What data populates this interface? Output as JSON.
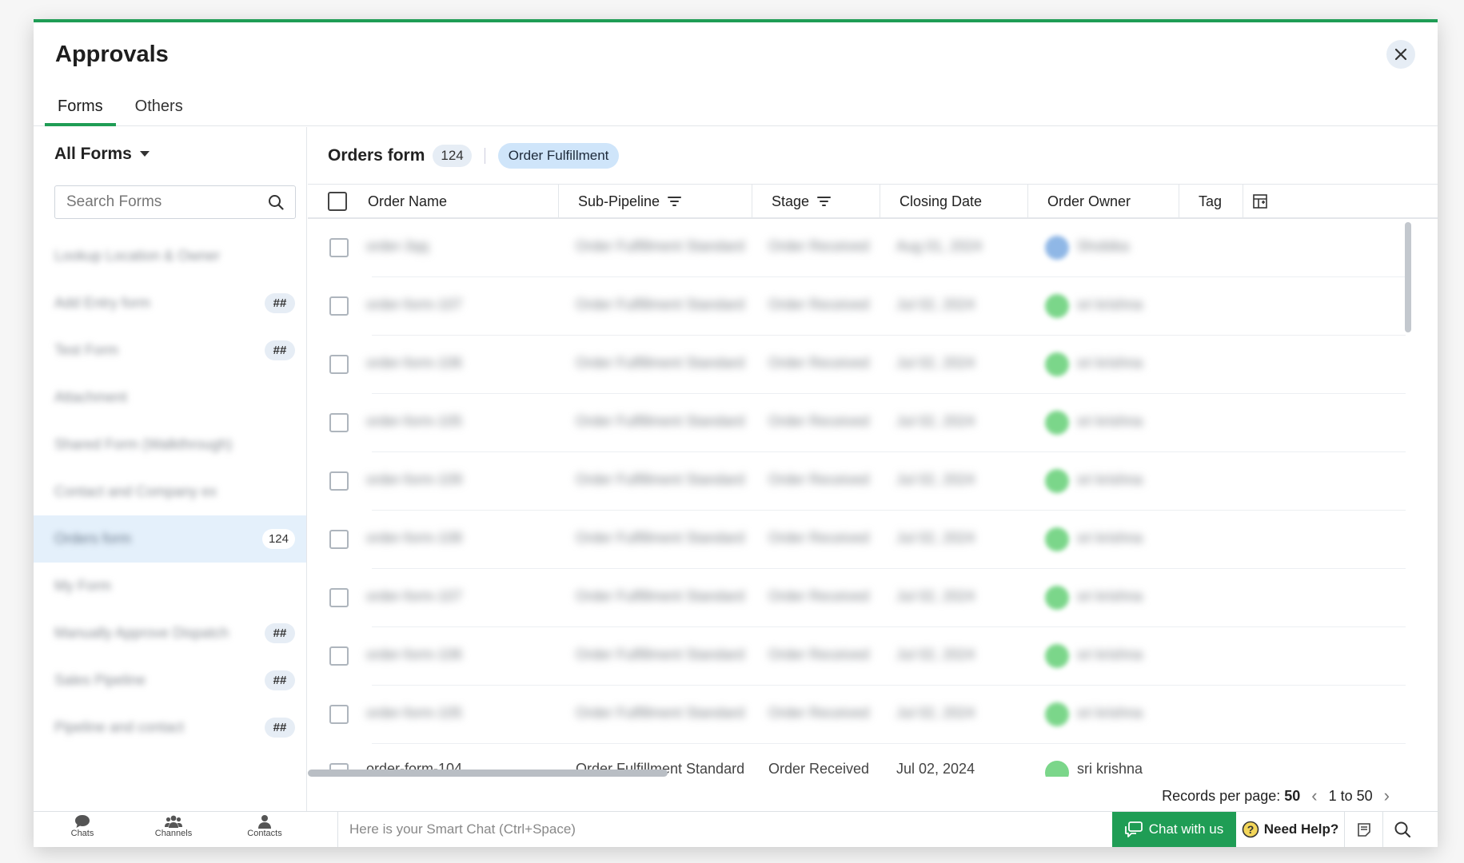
{
  "title": "Approvals",
  "tabs": [
    "Forms",
    "Others"
  ],
  "sidebar": {
    "dropdown_label": "All Forms",
    "search_placeholder": "Search Forms",
    "items": [
      {
        "name": "Lookup Location & Owner",
        "badge": ""
      },
      {
        "name": "Add Entry form",
        "badge": "##"
      },
      {
        "name": "Test Form",
        "badge": "##"
      },
      {
        "name": "Attachment",
        "badge": ""
      },
      {
        "name": "Shared Form (Walkthrough)",
        "badge": ""
      },
      {
        "name": "Contact and Company ex",
        "badge": ""
      },
      {
        "name": "Orders form",
        "badge": "124",
        "selected": true
      },
      {
        "name": "My Form",
        "badge": ""
      },
      {
        "name": "Manually Approve Dispatch",
        "badge": "##"
      },
      {
        "name": "Sales Pipeline",
        "badge": "##"
      },
      {
        "name": "Pipeline and contact",
        "badge": "##"
      }
    ]
  },
  "main": {
    "form_title": "Orders form",
    "record_count": "124",
    "pipeline": "Order Fulfillment",
    "columns": [
      "Order Name",
      "Sub-Pipeline",
      "Stage",
      "Closing Date",
      "Order Owner",
      "Tag"
    ],
    "rows": [
      {
        "order": "order-3qq",
        "sub": "Order Fulfillment Standard",
        "stage": "Order Received",
        "date": "Aug 01, 2024",
        "owner": "Shobika",
        "avatar": "blue"
      },
      {
        "order": "order-form-107",
        "sub": "Order Fulfillment Standard",
        "stage": "Order Received",
        "date": "Jul 02, 2024",
        "owner": "sri krishna",
        "avatar": "green"
      },
      {
        "order": "order-form-106",
        "sub": "Order Fulfillment Standard",
        "stage": "Order Received",
        "date": "Jul 02, 2024",
        "owner": "sri krishna",
        "avatar": "green"
      },
      {
        "order": "order-form-105",
        "sub": "Order Fulfillment Standard",
        "stage": "Order Received",
        "date": "Jul 02, 2024",
        "owner": "sri krishna",
        "avatar": "green"
      },
      {
        "order": "order-form-109",
        "sub": "Order Fulfillment Standard",
        "stage": "Order Received",
        "date": "Jul 02, 2024",
        "owner": "sri krishna",
        "avatar": "green"
      },
      {
        "order": "order-form-108",
        "sub": "Order Fulfillment Standard",
        "stage": "Order Received",
        "date": "Jul 02, 2024",
        "owner": "sri krishna",
        "avatar": "green"
      },
      {
        "order": "order-form-107",
        "sub": "Order Fulfillment Standard",
        "stage": "Order Received",
        "date": "Jul 02, 2024",
        "owner": "sri krishna",
        "avatar": "green"
      },
      {
        "order": "order-form-106",
        "sub": "Order Fulfillment Standard",
        "stage": "Order Received",
        "date": "Jul 02, 2024",
        "owner": "sri krishna",
        "avatar": "green"
      },
      {
        "order": "order-form-105",
        "sub": "Order Fulfillment Standard",
        "stage": "Order Received",
        "date": "Jul 02, 2024",
        "owner": "sri krishna",
        "avatar": "green"
      },
      {
        "order": "order-form-104",
        "sub": "Order Fulfillment Standard",
        "stage": "Order Received",
        "date": "Jul 02, 2024",
        "owner": "sri krishna",
        "avatar": "green",
        "partial": true
      }
    ],
    "pager": {
      "label": "Records per page:",
      "per_page": "50",
      "range": "1 to 50"
    }
  },
  "bottombar": {
    "nav": [
      "Chats",
      "Channels",
      "Contacts"
    ],
    "smart_chat_placeholder": "Here is your Smart Chat (Ctrl+Space)",
    "chat_button": "Chat with us",
    "help_button": "Need Help?"
  },
  "colors": {
    "accent": "#1f9d55",
    "selected_bg": "#e4f0fb",
    "pill_bg": "#cfe5fa"
  }
}
